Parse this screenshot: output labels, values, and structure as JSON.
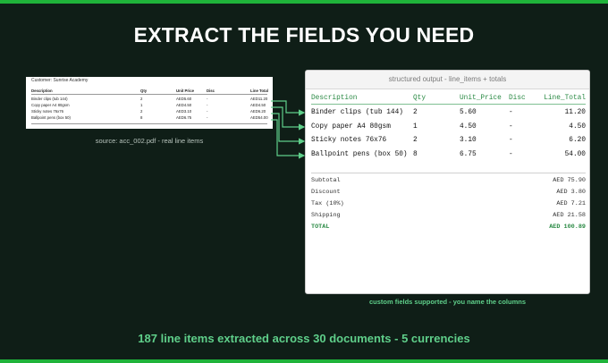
{
  "headline": "EXTRACT THE FIELDS YOU NEED",
  "source": {
    "customer": "Customer: Sunrise Academy",
    "headers": [
      "Description",
      "Qty",
      "Unit Price",
      "Disc",
      "Line Total"
    ],
    "rows": [
      [
        "Binder clips (tub 144)",
        "2",
        "AED5.60",
        "-",
        "AED11.20"
      ],
      [
        "Copy paper A4 80gsm",
        "1",
        "AED4.50",
        "-",
        "AED4.50"
      ],
      [
        "Sticky notes 76x76",
        "2",
        "AED3.10",
        "-",
        "AED6.20"
      ],
      [
        "Ballpoint pens (box 50)",
        "8",
        "AED6.75",
        "-",
        "AED54.00"
      ]
    ],
    "caption": "source: acc_002.pdf - real line items"
  },
  "output": {
    "title": "structured output - line_items + totals",
    "headers": [
      "Description",
      "Qty",
      "Unit_Price",
      "Disc",
      "Line_Total"
    ],
    "rows": [
      [
        "Binder clips (tub 144)",
        "2",
        "5.60",
        "-",
        "11.20"
      ],
      [
        "Copy paper A4 80gsm",
        "1",
        "4.50",
        "-",
        "4.50"
      ],
      [
        "Sticky notes 76x76",
        "2",
        "3.10",
        "-",
        "6.20"
      ],
      [
        "Ballpoint pens (box 50)",
        "8",
        "6.75",
        "-",
        "54.00"
      ]
    ],
    "totals": [
      {
        "label": "Subtotal",
        "value": "AED 75.90"
      },
      {
        "label": "Discount",
        "value": "AED 3.80"
      },
      {
        "label": "Tax (10%)",
        "value": "AED 7.21"
      },
      {
        "label": "Shipping",
        "value": "AED 21.58"
      },
      {
        "label": "TOTAL",
        "value": "AED 100.89"
      }
    ],
    "caption": "custom fields supported - you name the columns"
  },
  "footer": "187 line items extracted across 30 documents - 5 currencies",
  "colors": {
    "accent": "#1fb33a",
    "highlight": "#5fcf8a",
    "background": "#0f1e17"
  }
}
